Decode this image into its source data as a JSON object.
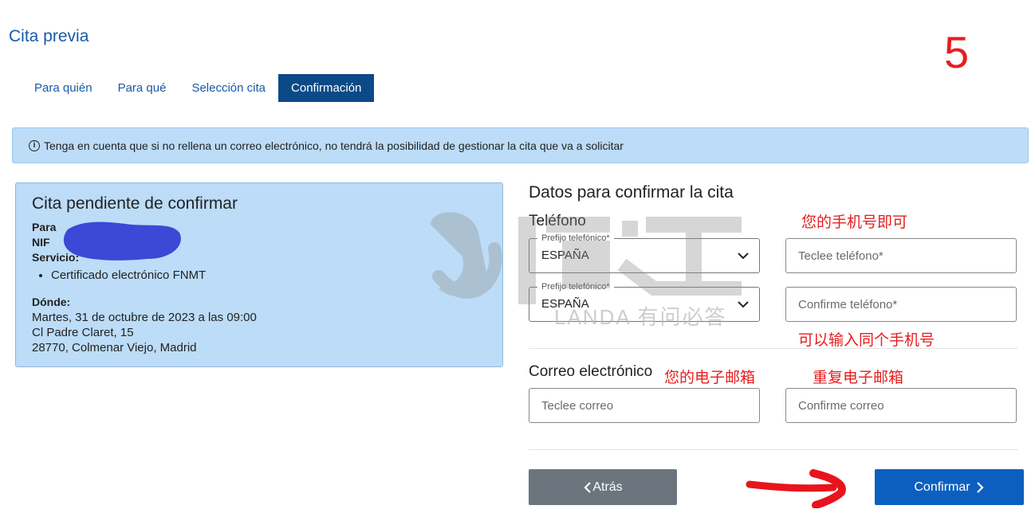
{
  "header": {
    "title": "Cita previa",
    "step_number": "5"
  },
  "tabs": [
    {
      "label": "Para quién",
      "active": false
    },
    {
      "label": "Para qué",
      "active": false
    },
    {
      "label": "Selección cita",
      "active": false
    },
    {
      "label": "Confirmación",
      "active": true
    }
  ],
  "info_banner": {
    "icon": "info-icon",
    "text": "Tenga en cuenta que si no rellena un correo electrónico, no tendrá la posibilidad de gestionar la cita que va a solicitar"
  },
  "summary": {
    "title": "Cita pendiente de confirmar",
    "para_label": "Para",
    "nif_label": "NIF",
    "servicio_label": "Servicio:",
    "services": [
      "Certificado electrónico FNMT"
    ],
    "donde_label": "Dónde:",
    "date": "Martes, 31 de octubre de 2023 a las 09:00",
    "address_line1": "Cl Padre Claret, 15",
    "address_line2": "28770, Colmenar Viejo, Madrid"
  },
  "form": {
    "heading": "Datos para confirmar la cita",
    "phone_section": "Teléfono",
    "prefix_legend": "Prefijo telefónico*",
    "prefix_value": "ESPAÑA",
    "phone_placeholder": "Teclee teléfono*",
    "phone_confirm_placeholder": "Confirme teléfono*",
    "email_section": "Correo electrónico",
    "email_placeholder": "Teclee correo",
    "email_confirm_placeholder": "Confirme correo"
  },
  "buttons": {
    "back_label": "Atrás",
    "confirm_label": "Confirmar"
  },
  "annotations": {
    "phone_note": "您的手机号即可",
    "same_phone_note": "可以输入同个手机号",
    "email_note": "您的电子邮箱",
    "repeat_email_note": "重复电子邮箱"
  },
  "watermark": {
    "text": "LANDA 有问必答"
  },
  "colors": {
    "brand_blue": "#1a5aa6",
    "active_tab": "#0b4a87",
    "info_bg": "#bcdcf7",
    "confirm_button": "#0c5fbf",
    "back_button": "#6c757d",
    "annotation_red": "#e61e1e"
  }
}
